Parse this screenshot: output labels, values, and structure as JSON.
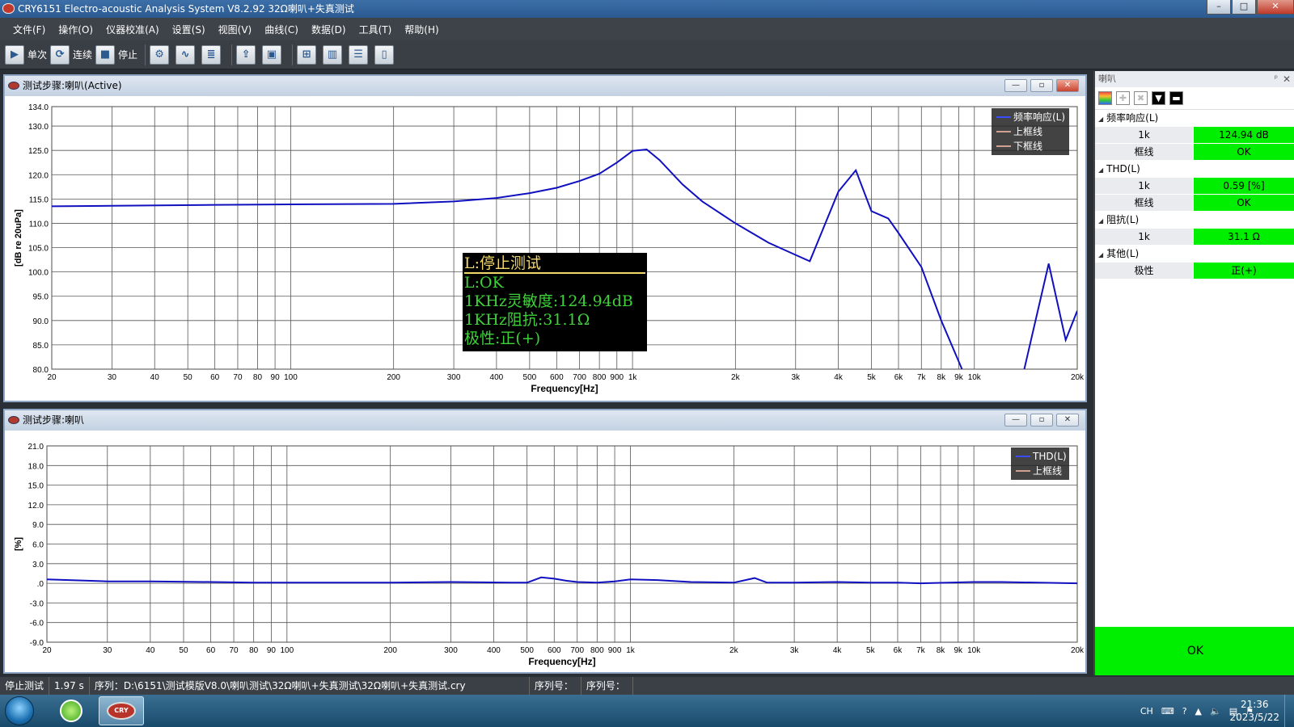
{
  "window": {
    "title": "CRY6151 Electro-acoustic Analysis System  V8.2.92 32Ω喇叭+失真测试",
    "min": "–",
    "max": "□",
    "close": "✕"
  },
  "menu": [
    "文件(F)",
    "操作(O)",
    "仪器校准(A)",
    "设置(S)",
    "视图(V)",
    "曲线(C)",
    "数据(D)",
    "工具(T)",
    "帮助(H)"
  ],
  "toolbar": {
    "single": "单次",
    "continuous": "连续",
    "stop": "停止"
  },
  "panel_top": {
    "title": "测试步骤:喇叭(Active)"
  },
  "panel_bottom": {
    "title": "测试步骤:喇叭"
  },
  "panel_buttons": {
    "min": "—",
    "restore": "▫",
    "close": "✕"
  },
  "overlay": {
    "title": "L:停止测试",
    "lines": [
      "L:OK",
      "1KHz灵敏度:124.94dB",
      "1KHz阻抗:31.1Ω",
      "极性:正(+)"
    ]
  },
  "chart_data": [
    {
      "type": "line",
      "xscale": "log",
      "xlabel": "Frequency[Hz]",
      "ylabel": "[dB re 20uPa]",
      "xlim": [
        20,
        20000
      ],
      "ylim": [
        80,
        134
      ],
      "yticks": [
        "134.0",
        "130.0",
        "125.0",
        "120.0",
        "115.0",
        "110.0",
        "105.0",
        "100.0",
        "95.0",
        "90.0",
        "85.0",
        "80.0"
      ],
      "ytick_values": [
        134,
        130,
        125,
        120,
        115,
        110,
        105,
        100,
        95,
        90,
        85,
        80
      ],
      "xticks": [
        "20",
        "30",
        "40",
        "50",
        "60",
        "70",
        "80",
        "90",
        "100",
        "200",
        "300",
        "400",
        "500",
        "600",
        "700",
        "800",
        "900",
        "1k",
        "2k",
        "3k",
        "4k",
        "5k",
        "6k",
        "7k",
        "8k",
        "9k",
        "10k",
        "20k"
      ],
      "xtick_values": [
        20,
        30,
        40,
        50,
        60,
        70,
        80,
        90,
        100,
        200,
        300,
        400,
        500,
        600,
        700,
        800,
        900,
        1000,
        2000,
        3000,
        4000,
        5000,
        6000,
        7000,
        8000,
        9000,
        10000,
        20000
      ],
      "grid": true,
      "legend": "top-right",
      "series": [
        {
          "name": "频率响应(L)",
          "color": "#1010c0",
          "x": [
            20,
            30,
            60,
            100,
            200,
            300,
            400,
            500,
            600,
            700,
            800,
            900,
            1000,
            1100,
            1200,
            1400,
            1600,
            2000,
            2500,
            3000,
            3300,
            4000,
            4500,
            5000,
            5600,
            6000,
            7000,
            8000,
            9200
          ],
          "y": [
            113.5,
            113.6,
            113.8,
            113.9,
            114.0,
            114.5,
            115.2,
            116.2,
            117.3,
            118.7,
            120.2,
            122.5,
            124.9,
            125.2,
            123.0,
            118.0,
            114.5,
            110.0,
            106.0,
            103.5,
            102.2,
            116.5,
            120.9,
            112.5,
            111.0,
            108.0,
            101.0,
            90.0,
            80.0
          ]
        },
        {
          "name": "频率响应(L)",
          "color": "#1010c0",
          "x": [
            14000,
            16500,
            18500,
            20000
          ],
          "y": [
            80.0,
            101.7,
            86.0,
            92.0
          ]
        },
        {
          "name": "上框线",
          "color": "#c08070",
          "x": [],
          "y": []
        },
        {
          "name": "下框线",
          "color": "#c08070",
          "x": [],
          "y": []
        }
      ]
    },
    {
      "type": "line",
      "xscale": "log",
      "xlabel": "Frequency[Hz]",
      "ylabel": "[%]",
      "xlim": [
        20,
        20000
      ],
      "ylim": [
        -9,
        21
      ],
      "yticks": [
        "21.0",
        "18.0",
        "15.0",
        "12.0",
        "9.0",
        "6.0",
        "3.0",
        ".0",
        "-3.0",
        "-6.0",
        "-9.0"
      ],
      "ytick_values": [
        21,
        18,
        15,
        12,
        9,
        6,
        3,
        0,
        -3,
        -6,
        -9
      ],
      "xticks": [
        "20",
        "30",
        "40",
        "50",
        "60",
        "70",
        "80",
        "90",
        "100",
        "200",
        "300",
        "400",
        "500",
        "600",
        "700",
        "800",
        "900",
        "1k",
        "2k",
        "3k",
        "4k",
        "5k",
        "6k",
        "7k",
        "8k",
        "9k",
        "10k",
        "20k"
      ],
      "xtick_values": [
        20,
        30,
        40,
        50,
        60,
        70,
        80,
        90,
        100,
        200,
        300,
        400,
        500,
        600,
        700,
        800,
        900,
        1000,
        2000,
        3000,
        4000,
        5000,
        6000,
        7000,
        8000,
        9000,
        10000,
        20000
      ],
      "grid": true,
      "legend": "top-right",
      "series": [
        {
          "name": "THD(L)",
          "color": "#1010c0",
          "x": [
            20,
            30,
            40,
            60,
            80,
            100,
            200,
            300,
            450,
            500,
            550,
            600,
            650,
            700,
            800,
            900,
            1000,
            1200,
            1500,
            2000,
            2300,
            2500,
            3000,
            4000,
            5000,
            6000,
            7000,
            10000,
            12000,
            20000
          ],
          "y": [
            0.6,
            0.3,
            0.3,
            0.2,
            0.1,
            0.1,
            0.1,
            0.2,
            0.1,
            0.1,
            0.9,
            0.7,
            0.4,
            0.2,
            0.1,
            0.3,
            0.6,
            0.5,
            0.2,
            0.1,
            0.8,
            0.1,
            0.1,
            0.2,
            0.1,
            0.1,
            0.0,
            0.2,
            0.2,
            0.0
          ]
        },
        {
          "name": "上框线",
          "color": "#c08070",
          "x": [],
          "y": []
        }
      ]
    }
  ],
  "rpanel": {
    "title": "喇叭",
    "pin": "ᵖ",
    "x": "✕",
    "tools": [
      "▦",
      "✚",
      "✖",
      "▼",
      "▬"
    ],
    "groups": [
      {
        "name": "频率响应(L)",
        "rows": [
          {
            "k": "1k",
            "v": "124.94 dB"
          },
          {
            "k": "框线",
            "v": "OK"
          }
        ]
      },
      {
        "name": "THD(L)",
        "rows": [
          {
            "k": "1k",
            "v": "0.59 [%]"
          },
          {
            "k": "框线",
            "v": "OK"
          }
        ]
      },
      {
        "name": "阻抗(L)",
        "rows": [
          {
            "k": "1k",
            "v": "31.1 Ω"
          }
        ]
      },
      {
        "name": "其他(L)",
        "rows": [
          {
            "k": "极性",
            "v": "正(+)"
          }
        ]
      }
    ],
    "result": "OK"
  },
  "status": {
    "state": "停止测试",
    "time": "1.97 s",
    "sequence": "序列：D:\\6151\\测试模版V8.0\\喇叭测试\\32Ω喇叭+失真测试\\32Ω喇叭+失真测试.cry",
    "serial1": "序列号：",
    "serial2": "序列号："
  },
  "taskbar": {
    "app2_label": "CRY",
    "tray_lang": "CH",
    "tray_help": "?",
    "time": "21:36",
    "date": "2023/5/22"
  }
}
